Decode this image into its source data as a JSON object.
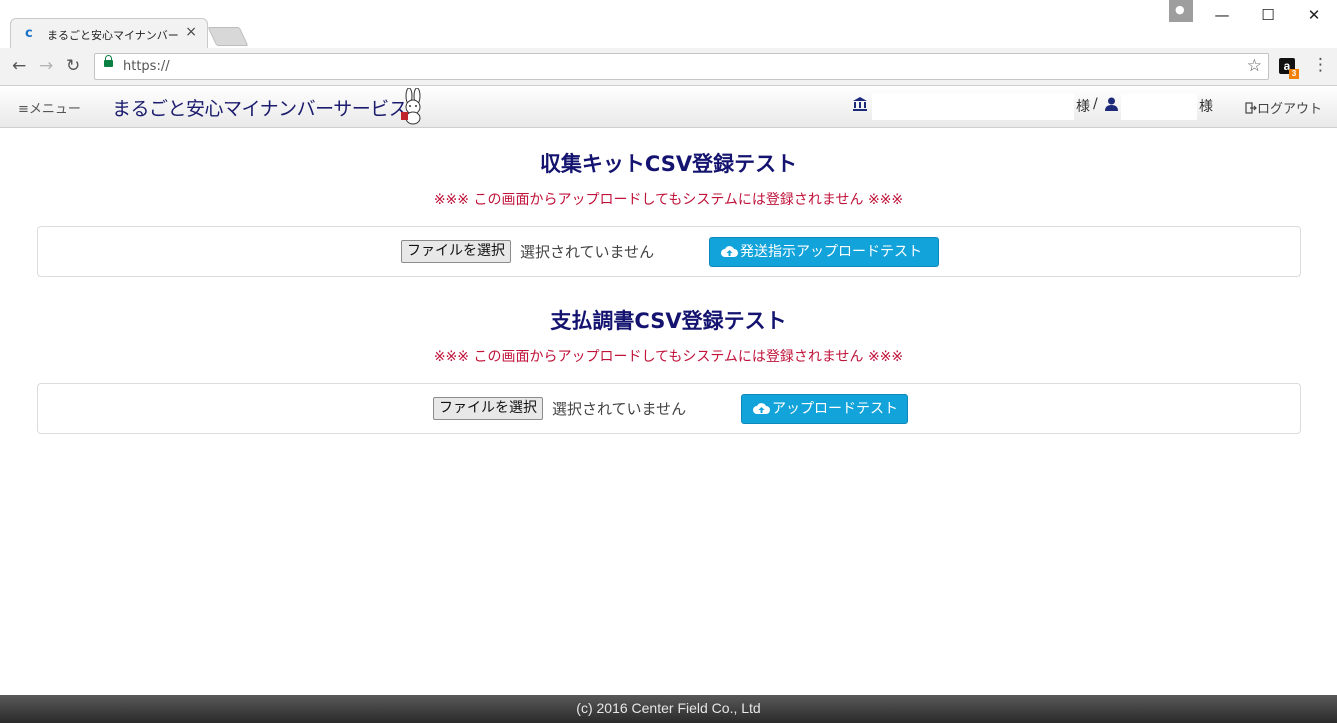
{
  "browser": {
    "tab_title": "まるごと安心マイナンバー",
    "tab_close": "×",
    "favicon": "c",
    "url": "https://",
    "minimize": "—",
    "maximize": "☐",
    "close": "✕",
    "back": "←",
    "forward": "→",
    "reload": "↻",
    "bookmark": "☆",
    "extension_label": "a",
    "extension_badge": "3",
    "menu": "⋮"
  },
  "header": {
    "menu_label": "≡メニュー",
    "brand": "まるごと安心マイナンバーサービス",
    "org_suffix": "様",
    "separator": "/",
    "user_suffix": "様",
    "logout_label": "ログアウト",
    "icons": [
      "bank-icon",
      "user-icon",
      "logout-icon",
      "menu-icon"
    ]
  },
  "sections": [
    {
      "title": "収集キットCSV登録テスト",
      "warning": "※※※ この画面からアップロードしてもシステムには登録されません ※※※",
      "file_button": "ファイルを選択",
      "file_status": "選択されていません",
      "upload_button": "発送指示アップロードテスト"
    },
    {
      "title": "支払調書CSV登録テスト",
      "warning": "※※※ この画面からアップロードしてもシステムには登録されません ※※※",
      "file_button": "ファイルを選択",
      "file_status": "選択されていません",
      "upload_button": "アップロードテスト"
    }
  ],
  "footer": {
    "copyright": "(c) 2016 Center Field Co., Ltd"
  },
  "colors": {
    "title": "#141470",
    "warning": "#c0133a",
    "upload_button": "#13a3db",
    "brand": "#1c1c6e"
  }
}
